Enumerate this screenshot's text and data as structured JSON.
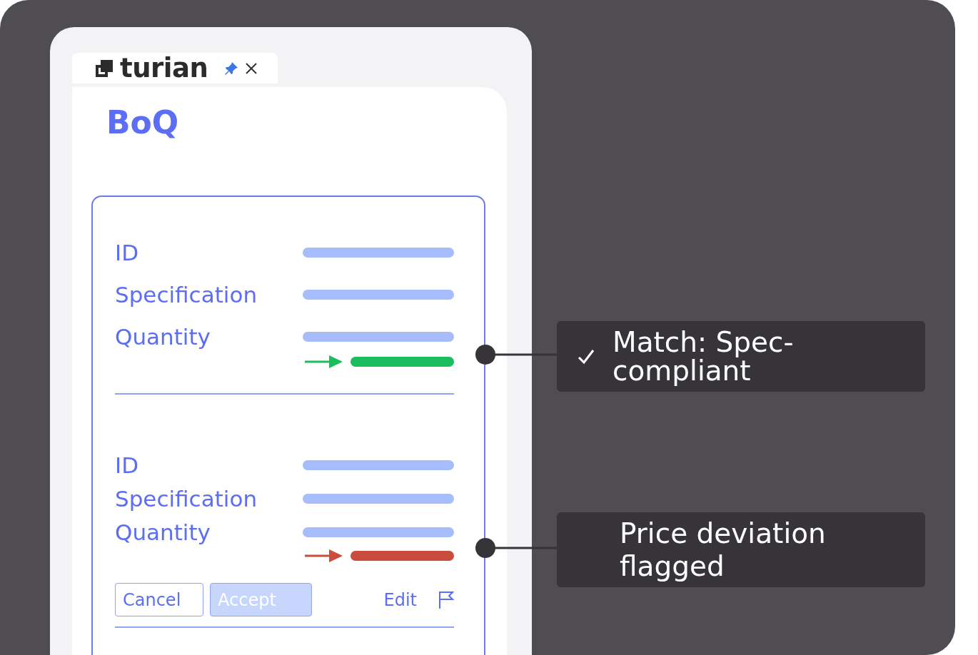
{
  "tab": {
    "logo": "turian",
    "pinned": true
  },
  "title": "BoQ",
  "groups": [
    {
      "fields": [
        {
          "label": "ID"
        },
        {
          "label": "Specification"
        },
        {
          "label": "Quantity"
        }
      ],
      "result": {
        "kind": "match"
      }
    },
    {
      "fields": [
        {
          "label": "ID"
        },
        {
          "label": "Specification"
        },
        {
          "label": "Quantity"
        }
      ],
      "result": {
        "kind": "deviation"
      }
    }
  ],
  "actions": {
    "buttons": [
      {
        "label": "Cancel",
        "kind": "outline"
      },
      {
        "label": "Accept",
        "kind": "filled"
      }
    ],
    "link": "Edit"
  },
  "callouts": [
    {
      "text": "Match: Spec-compliant",
      "checked": true
    },
    {
      "text": "Price deviation flagged",
      "checked": false
    }
  ]
}
